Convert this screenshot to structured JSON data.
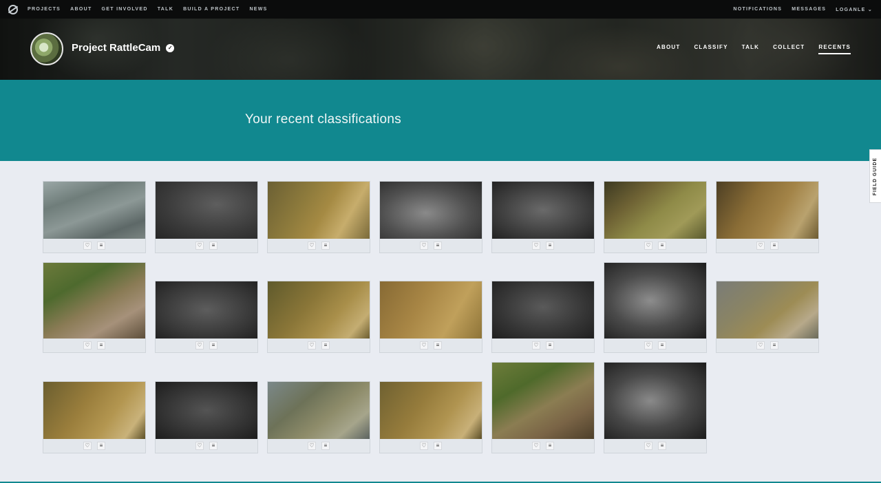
{
  "topnav": {
    "left_links": [
      "PROJECTS",
      "ABOUT",
      "GET INVOLVED",
      "TALK",
      "BUILD A PROJECT",
      "NEWS"
    ],
    "right_links": [
      "NOTIFICATIONS",
      "MESSAGES",
      "LOGANLE ⌄"
    ]
  },
  "project": {
    "name": "Project RattleCam",
    "verified_icon": "check-circle-icon",
    "nav": [
      "ABOUT",
      "CLASSIFY",
      "TALK",
      "COLLECT",
      "RECENTS"
    ],
    "active_nav": "RECENTS"
  },
  "hero": {
    "title": "Your recent classifications"
  },
  "field_guide": {
    "label": "FIELD GUIDE"
  },
  "card_actions": {
    "favorite_icon": "heart-icon",
    "collect_icon": "list-icon",
    "favorite_glyph": "♡",
    "collect_glyph": "≡"
  },
  "colors": {
    "teal": "#11888f",
    "topnav": "#0b0c0c",
    "page_bg": "#e9ecf2"
  }
}
